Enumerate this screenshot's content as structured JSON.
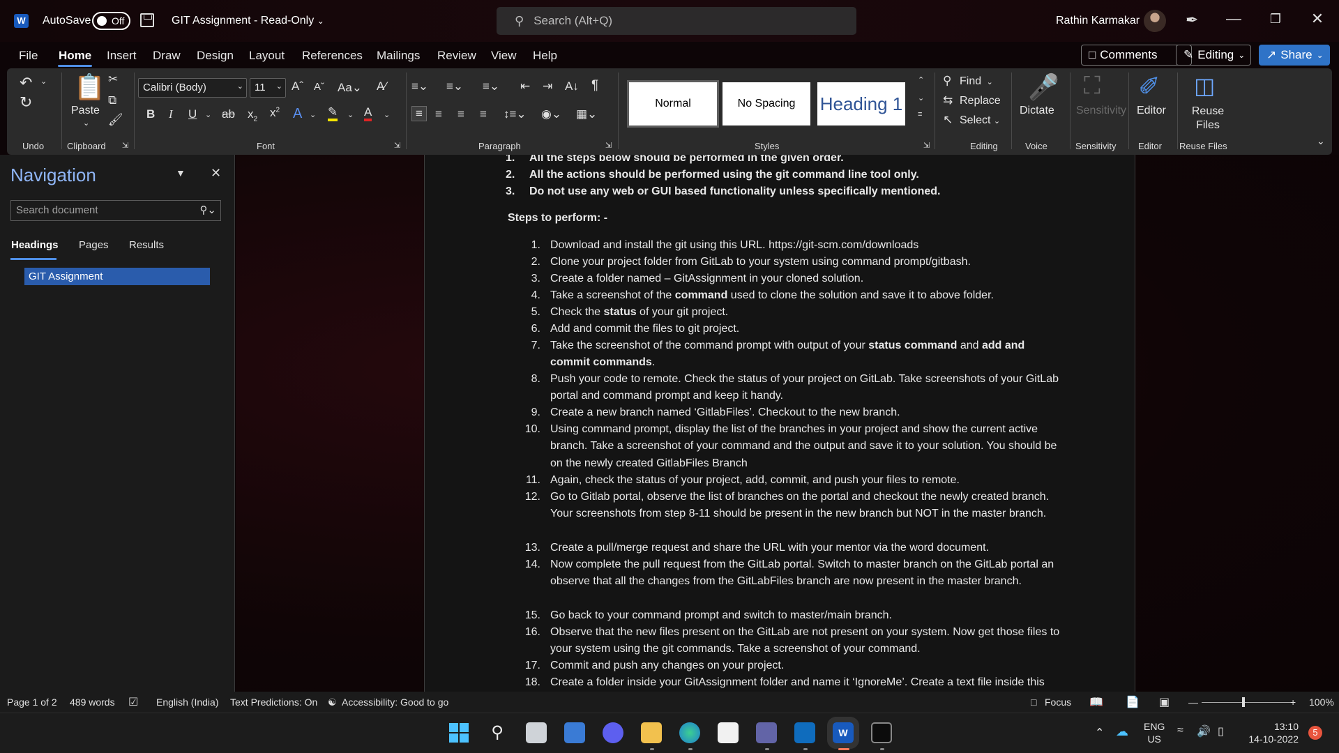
{
  "titlebar": {
    "app_icon": "W",
    "autosave_label": "AutoSave",
    "autosave_state": "Off",
    "document_title": "GIT Assignment  -  Read-Only",
    "search_placeholder": "Search (Alt+Q)",
    "user_name": "Rathin Karmakar"
  },
  "menu": {
    "tabs": [
      "File",
      "Home",
      "Insert",
      "Draw",
      "Design",
      "Layout",
      "References",
      "Mailings",
      "Review",
      "View",
      "Help"
    ],
    "active_tab": "Home",
    "comments_label": "Comments",
    "editing_label": "Editing",
    "share_label": "Share"
  },
  "ribbon": {
    "groups": {
      "undo": "Undo",
      "clipboard": "Clipboard",
      "font": "Font",
      "paragraph": "Paragraph",
      "styles": "Styles",
      "editing": "Editing",
      "voice": "Voice",
      "sensitivity": "Sensitivity",
      "editor": "Editor",
      "reuse_files": "Reuse Files"
    },
    "paste_label": "Paste",
    "font_name": "Calibri (Body)",
    "font_size": "11",
    "styles": [
      "Normal",
      "No Spacing",
      "Heading 1"
    ],
    "find_label": "Find",
    "replace_label": "Replace",
    "select_label": "Select",
    "dictate_label": "Dictate",
    "sensitivity_label": "Sensitivity",
    "editor_label": "Editor",
    "reuse_files_label": "Reuse Files"
  },
  "navigation": {
    "title": "Navigation",
    "search_placeholder": "Search document",
    "tabs": [
      "Headings",
      "Pages",
      "Results"
    ],
    "active_tab": "Headings",
    "headings": [
      "GIT Assignment"
    ]
  },
  "document": {
    "pre_items": [
      {
        "num": "1.",
        "text": "All the steps below should be performed in the given order."
      },
      {
        "num": "2.",
        "text": "All the actions should be performed using the git command line tool only."
      },
      {
        "num": "3.",
        "text": "Do not use any web or GUI based functionality unless specifically mentioned."
      }
    ],
    "steps_heading": "Steps to perform: -",
    "steps": [
      {
        "num": "1.",
        "text": "Download and install the git using this URL. https://git-scm.com/downloads"
      },
      {
        "num": "2.",
        "text": "Clone your project folder from GitLab to your system using command prompt/gitbash."
      },
      {
        "num": "3.",
        "text": "Create a folder named – GitAssignment in your cloned solution."
      },
      {
        "num": "4.",
        "text_a": "Take a screenshot of the ",
        "bold_a": "command",
        "text_b": " used to clone the solution and save it to above folder."
      },
      {
        "num": "5.",
        "text_a": "Check the ",
        "bold_a": "status",
        "text_b": " of your git project."
      },
      {
        "num": "6.",
        "text": "Add and commit the files to git project."
      },
      {
        "num": "7.",
        "text_a": "Take the screenshot of the command prompt with output of your ",
        "bold_a": "status command",
        "text_b": " and ",
        "bold_b": "add and commit commands",
        "text_c": "."
      },
      {
        "num": "8.",
        "text": "Push your code to remote. Check the status of your project on GitLab. Take screenshots of your GitLab portal and command prompt and keep it handy."
      },
      {
        "num": "9.",
        "text": "Create a new branch named ‘GitlabFiles’. Checkout to the new branch."
      },
      {
        "num": "10.",
        "text": "Using command prompt, display the list of the branches in your project and show the current active branch. Take a screenshot of your command and the output and save it to your solution. You should be on the newly created GitlabFiles Branch"
      },
      {
        "num": "11.",
        "text": "Again, check the status of your project, add, commit, and push your files to remote."
      },
      {
        "num": "12.",
        "text": "Go to Gitlab portal, observe the list of branches on the portal and checkout the newly created branch. Your screenshots from step 8-11 should be present in the new branch but NOT in the master branch."
      },
      {
        "num": "13.",
        "text": "Create a pull/merge request and share the URL with your mentor via the word document."
      },
      {
        "num": "14.",
        "text": "Now complete the pull request from the GitLab portal. Switch to master branch on the GitLab portal an observe that all the changes from the GitLabFiles branch are now present in the master branch."
      },
      {
        "num": "15.",
        "text": "Go back to your command prompt and switch to master/main branch."
      },
      {
        "num": "16.",
        "text": "Observe that the new files present on the GitLab are not present on your system. Now get those files to your system using the git commands. Take a screenshot of your command."
      },
      {
        "num": "17.",
        "text": "Commit and push any changes on your project."
      },
      {
        "num": "18.",
        "text": "Create a folder inside your GitAssignment folder and name it ‘IgnoreMe’. Create a text file inside this new folder and name it ‘InsideIgnoreMe.txt’."
      }
    ]
  },
  "statusbar": {
    "page": "Page 1 of 2",
    "words": "489 words",
    "language": "English (India)",
    "text_predictions": "Text Predictions: On",
    "accessibility": "Accessibility: Good to go",
    "focus": "Focus",
    "zoom": "100%"
  },
  "taskbar": {
    "lang_top": "ENG",
    "lang_bottom": "US",
    "time": "13:10",
    "date": "14-10-2022",
    "notification_count": "5"
  },
  "colors": {
    "accent": "#4f8fe6",
    "share": "#2f73c7",
    "nav_selected": "#2a5cac",
    "spell_squiggle": "#c94a4a"
  }
}
